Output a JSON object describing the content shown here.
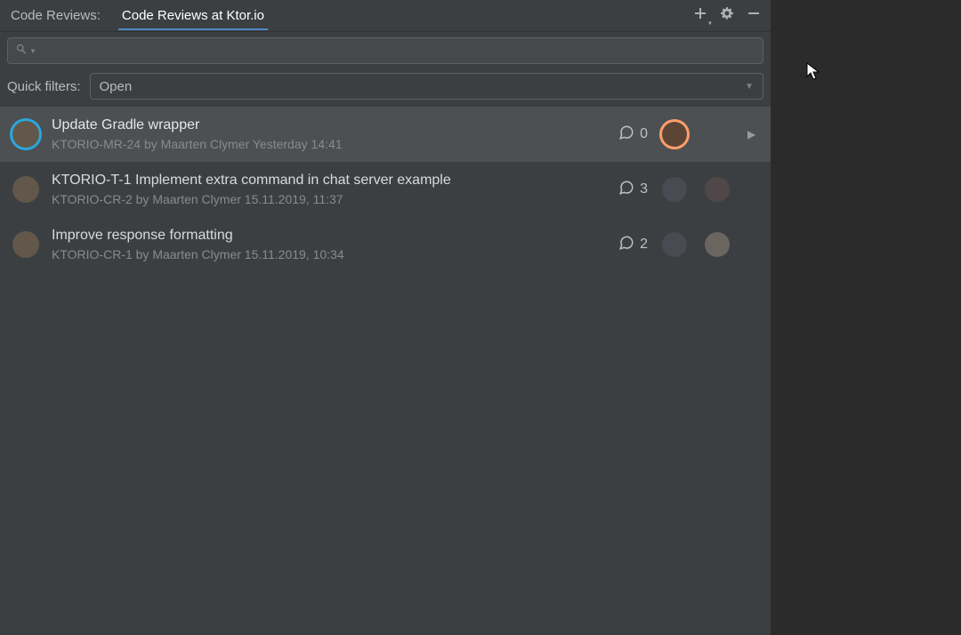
{
  "header": {
    "title": "Code Reviews:",
    "tab": "Code Reviews at Ktor.io"
  },
  "search": {
    "placeholder": ""
  },
  "filters": {
    "label": "Quick filters:",
    "selected": "Open"
  },
  "reviews": [
    {
      "title": "Update Gradle wrapper",
      "meta": "KTORIO-MR-24 by Maarten Clymer Yesterday 14:41",
      "comments": "0",
      "selected": true,
      "reviewerCount": 1
    },
    {
      "title": "KTORIO-T-1 Implement extra command in chat server example",
      "meta": "KTORIO-CR-2 by Maarten Clymer 15.11.2019, 11:37",
      "comments": "3",
      "selected": false,
      "reviewerCount": 2
    },
    {
      "title": "Improve response formatting",
      "meta": "KTORIO-CR-1 by Maarten Clymer 15.11.2019, 10:34",
      "comments": "2",
      "selected": false,
      "reviewerCount": 2
    }
  ]
}
